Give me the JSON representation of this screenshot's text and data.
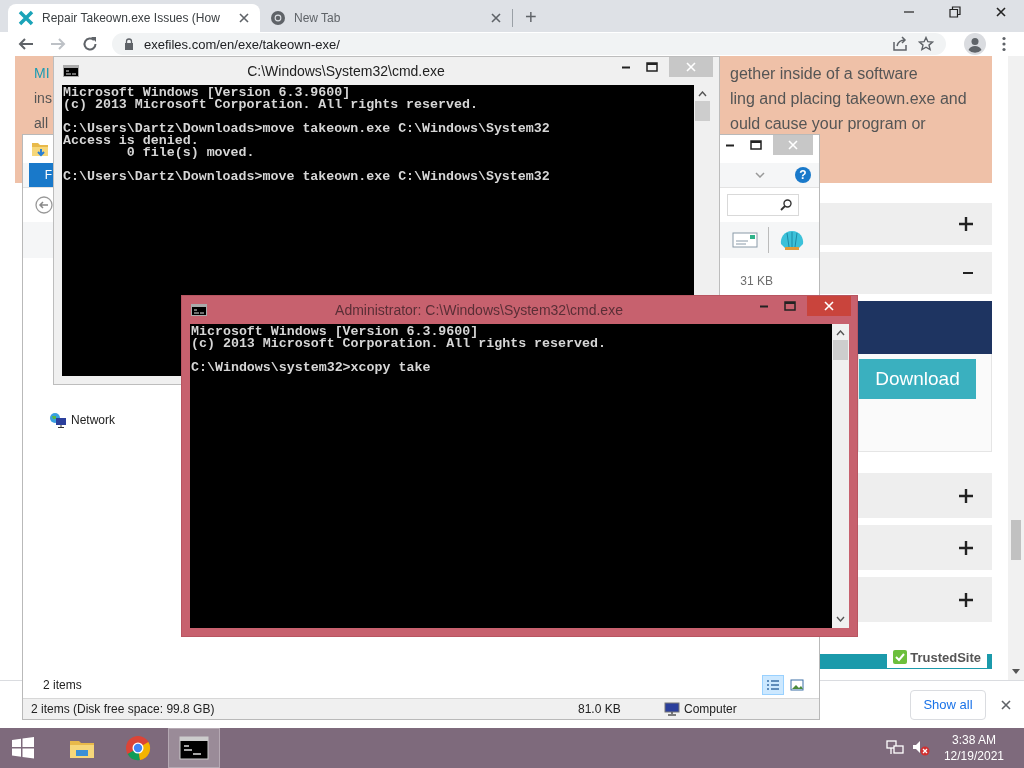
{
  "browser": {
    "tabs": [
      {
        "title": "Repair Takeown.exe Issues (How",
        "selected": true
      },
      {
        "title": "New Tab",
        "selected": false
      }
    ],
    "new_tab": "+",
    "address": "exefiles.com/en/exe/takeown-exe/",
    "page": {
      "intro_left": [
        "MI",
        "ins",
        "all"
      ],
      "intro_right": [
        "gether inside of a software",
        "ling and placing takeown.exe and",
        "ould cause your program or"
      ],
      "accordion": [
        {
          "expanded": false
        },
        {
          "expanded": true,
          "button": "Download"
        },
        {
          "expanded": false
        },
        {
          "expanded": false
        },
        {
          "expanded": false
        }
      ],
      "trust_badge": "TrustedSite"
    },
    "downloads_bar": {
      "show_all": "Show all"
    }
  },
  "explorer": {
    "ribbon_tab": "F",
    "help": "?",
    "file_size": "31 KB",
    "network": "Network",
    "item_count": "2 items",
    "views": [
      {
        "selected": true
      },
      {
        "selected": false
      }
    ],
    "status": {
      "summary": "2 items (Disk free space: 99.8 GB)",
      "size": "81.0 KB",
      "location": "Computer"
    }
  },
  "consoles": [
    {
      "title": "C:\\Windows\\System32\\cmd.exe",
      "active": false,
      "blocks": [
        [
          "Microsoft Windows [Version 6.3.9600]",
          "(c) 2013 Microsoft Corporation. All rights reserved."
        ],
        [
          "C:\\Users\\Dartz\\Downloads>move takeown.exe C:\\Windows\\System32",
          "Access is denied.",
          "        0 file(s) moved."
        ],
        [
          "C:\\Users\\Dartz\\Downloads>move takeown.exe C:\\Windows\\System32"
        ]
      ]
    },
    {
      "title": "Administrator: C:\\Windows\\System32\\cmd.exe",
      "active": true,
      "blocks": [
        [
          "Microsoft Windows [Version 6.3.9600]",
          "(c) 2013 Microsoft Corporation. All rights reserved."
        ],
        [
          "C:\\Windows\\system32>xcopy take"
        ]
      ]
    }
  ],
  "taskbar": {
    "apps": [
      {
        "kind": "explorer",
        "selected": false
      },
      {
        "kind": "browser",
        "selected": false
      },
      {
        "kind": "console",
        "selected": true
      }
    ],
    "time": "3:38 AM",
    "date": "12/19/2021"
  }
}
